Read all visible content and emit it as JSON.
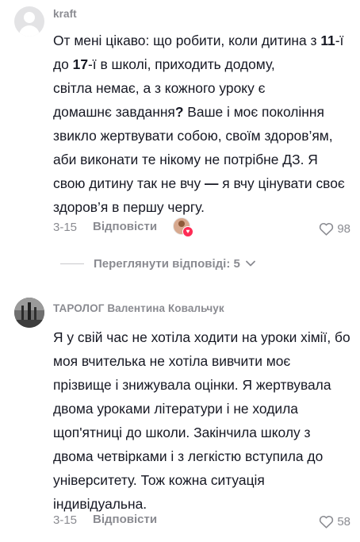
{
  "comments": [
    {
      "username": "kraft",
      "text_parts": [
        {
          "t": "От мені цікаво: що робити, коли дитина з "
        },
        {
          "t": "11",
          "b": true
        },
        {
          "t": "-ї до "
        },
        {
          "t": "17",
          "b": true
        },
        {
          "t": "-ї в школі, приходить додому,\nсвітла немає, а з кожного уроку є\nдомашнє завдання"
        },
        {
          "t": "?",
          "b": true
        },
        {
          "t": " Ваше і моє покоління звикло жертвувати собою, своїм здоров’ям, аби виконати те нікому не потрібне ДЗ. Я свою дитину так не вчу "
        },
        {
          "t": "—",
          "b": true
        },
        {
          "t": " я вчу цінувати своє здоров’я в першу чергу."
        }
      ],
      "date": "3-15",
      "reply_label": "Відповісти",
      "likes": "98",
      "has_creator_like": true,
      "view_replies_label": "Переглянути відповіді: 5"
    },
    {
      "username": "ТАРОЛОГ Валентина Ковальчук",
      "text": "Я у свій час не хотіла ходити на уроки хімії, бо моя вчителька не хотіла вивчити моє прізвище і знижувала оцінки. Я жертвувала двома уроками літератури і не ходила щоп'ятниці до школи. Закінчила школу з двома четвірками і з легкістю вступила до університету. Тож кожна ситуація індивідуальна.",
      "date": "3-15",
      "reply_label": "Відповісти",
      "likes": "58"
    }
  ],
  "icons": {
    "heart_outline": "heart-outline-icon",
    "chevron_down": "chevron-down-icon",
    "creator_like": "creator-liked-icon"
  },
  "colors": {
    "text": "#161823",
    "muted": "#8a8b91",
    "accent": "#fe2c55"
  }
}
